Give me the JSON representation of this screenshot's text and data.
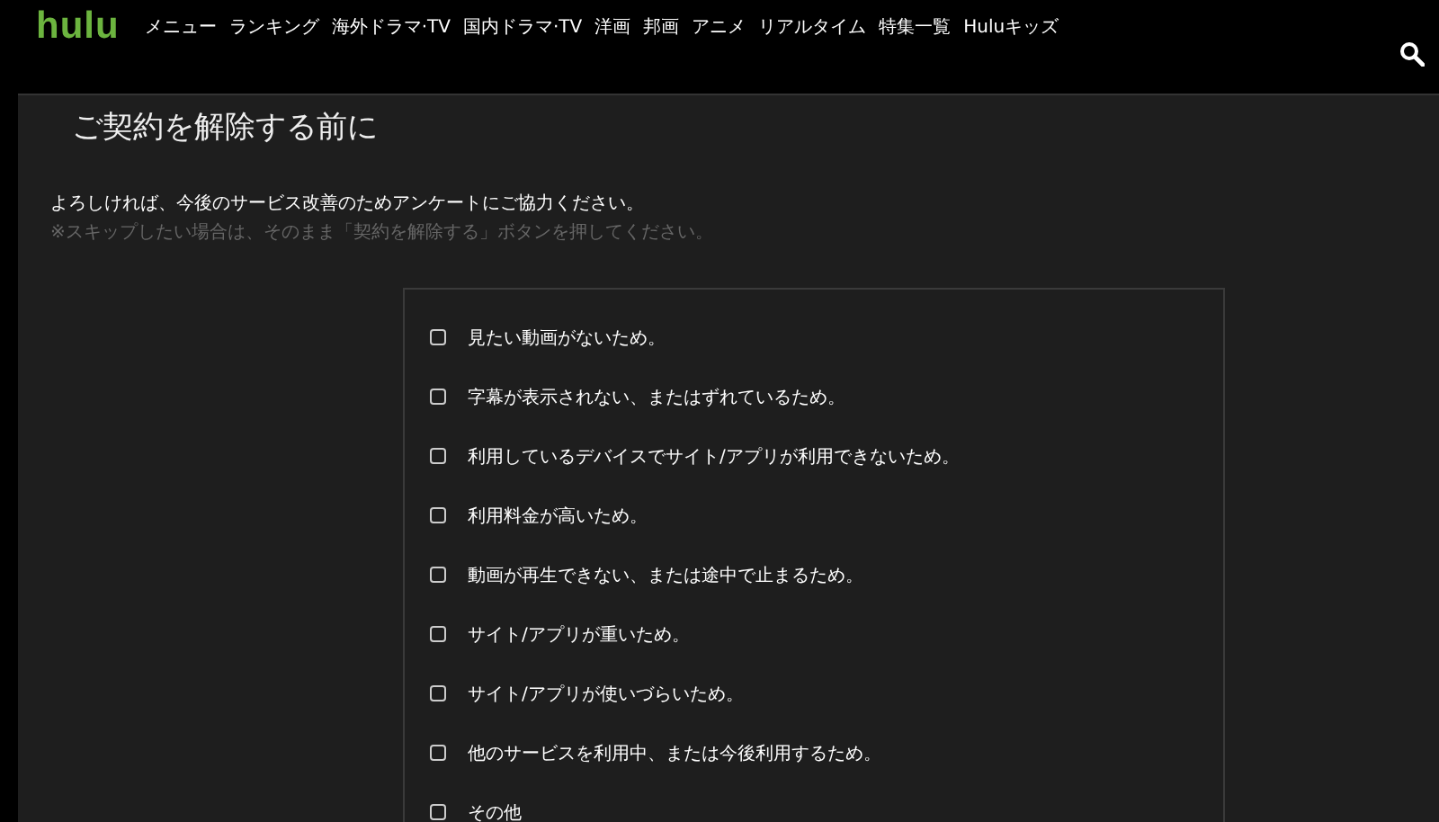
{
  "header": {
    "logo": "hulu",
    "nav": [
      {
        "label": "メニュー"
      },
      {
        "label": "ランキング"
      },
      {
        "label": "海外ドラマ·TV"
      },
      {
        "label": "国内ドラマ·TV"
      },
      {
        "label": "洋画"
      },
      {
        "label": "邦画"
      },
      {
        "label": "アニメ"
      },
      {
        "label": "リアルタイム"
      },
      {
        "label": "特集一覧"
      },
      {
        "label": "Huluキッズ"
      }
    ]
  },
  "title": "ご契約を解除する前に",
  "intro": "よろしければ、今後のサービス改善のためアンケートにご協力ください。",
  "note": "※スキップしたい場合は、そのまま「契約を解除する」ボタンを押してください。",
  "reasons": [
    {
      "label": "見たい動画がないため。",
      "checked": false
    },
    {
      "label": "字幕が表示されない、またはずれているため。",
      "checked": false
    },
    {
      "label": "利用しているデバイスでサイト/アプリが利用できないため。",
      "checked": false
    },
    {
      "label": "利用料金が高いため。",
      "checked": false
    },
    {
      "label": "動画が再生できない、または途中で止まるため。",
      "checked": false
    },
    {
      "label": "サイト/アプリが重いため。",
      "checked": false
    },
    {
      "label": "サイト/アプリが使いづらいため。",
      "checked": false
    },
    {
      "label": "他のサービスを利用中、または今後利用するため。",
      "checked": false
    },
    {
      "label": "その他",
      "checked": false
    }
  ]
}
